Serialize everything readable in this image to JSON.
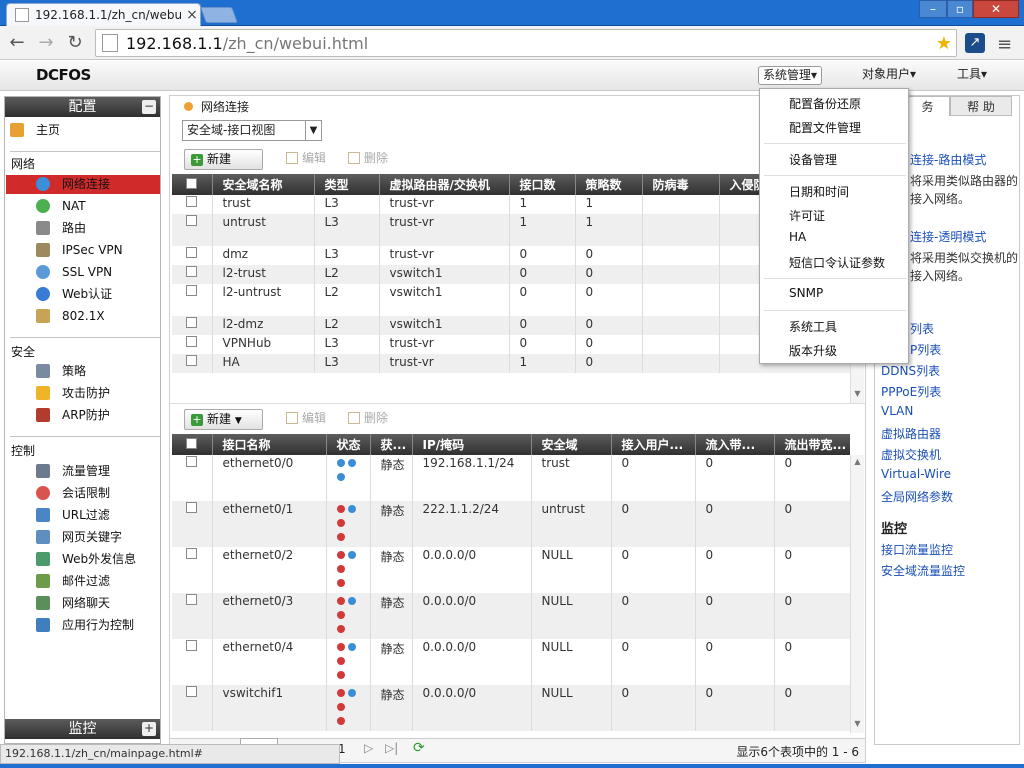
{
  "browser": {
    "tab_title": "192.168.1.1/zh_cn/webu",
    "url_host": "192.168.1.1",
    "url_path": "/zh_cn/webui.html",
    "status_url": "192.168.1.1/zh_cn/mainpage.html#"
  },
  "header": {
    "logo": "DCFOS",
    "menu": [
      "系统管理▾",
      "对象用户▾",
      "工具▾"
    ]
  },
  "sidebar": {
    "config_title": "配置",
    "home": "主页",
    "sections": [
      {
        "title": "网络",
        "items": [
          "网络连接",
          "NAT",
          "路由",
          "IPSec VPN",
          "SSL VPN",
          "Web认证",
          "802.1X"
        ]
      },
      {
        "title": "安全",
        "items": [
          "策略",
          "攻击防护",
          "ARP防护"
        ]
      },
      {
        "title": "控制",
        "items": [
          "流量管理",
          "会话限制",
          "URL过滤",
          "网页关键字",
          "Web外发信息",
          "邮件过滤",
          "网络聊天",
          "应用行为控制"
        ]
      }
    ],
    "selected": "网络连接",
    "monitor_title": "监控"
  },
  "main": {
    "breadcrumb": "网络连接",
    "view_select": "安全域-接口视图",
    "toolbar_new": "新建",
    "toolbar_edit": "编辑",
    "toolbar_delete": "删除",
    "zones": {
      "columns": [
        "安全域名称",
        "类型",
        "虚拟路由器/交换机",
        "接口数",
        "策略数",
        "防病毒",
        "入侵防"
      ],
      "rows": [
        [
          "trust",
          "L3",
          "trust-vr",
          "1",
          "1"
        ],
        [
          "untrust",
          "L3",
          "trust-vr",
          "1",
          "1"
        ],
        [
          "dmz",
          "L3",
          "trust-vr",
          "0",
          "0"
        ],
        [
          "l2-trust",
          "L2",
          "vswitch1",
          "0",
          "0"
        ],
        [
          "l2-untrust",
          "L2",
          "vswitch1",
          "0",
          "0"
        ],
        [
          "l2-dmz",
          "L2",
          "vswitch1",
          "0",
          "0"
        ],
        [
          "VPNHub",
          "L3",
          "trust-vr",
          "0",
          "0"
        ],
        [
          "HA",
          "L3",
          "trust-vr",
          "1",
          "0"
        ]
      ]
    },
    "interfaces": {
      "columns": [
        "接口名称",
        "状态",
        "获...",
        "IP/掩码",
        "安全域",
        "接入用户...",
        "流入带...",
        "流出带宽..."
      ],
      "rows": [
        [
          "ethernet0/0",
          "静态",
          "192.168.1.1/24",
          "trust",
          "0",
          "0",
          "0"
        ],
        [
          "ethernet0/1",
          "静态",
          "222.1.1.2/24",
          "untrust",
          "0",
          "0",
          "0"
        ],
        [
          "ethernet0/2",
          "静态",
          "0.0.0.0/0",
          "NULL",
          "0",
          "0",
          "0"
        ],
        [
          "ethernet0/3",
          "静态",
          "0.0.0.0/0",
          "NULL",
          "0",
          "0",
          "0"
        ],
        [
          "ethernet0/4",
          "静态",
          "0.0.0.0/0",
          "NULL",
          "0",
          "0",
          "0"
        ],
        [
          "vswitchif1",
          "静态",
          "0.0.0.0/0",
          "NULL",
          "0",
          "0",
          "0"
        ]
      ]
    },
    "pager_page": "1",
    "pager_info": "显示6个表项中的 1 - 6"
  },
  "dropdown": {
    "groups": [
      [
        "配置备份还原",
        "配置文件管理"
      ],
      [
        "设备管理"
      ],
      [
        "日期和时间",
        "许可证",
        "HA",
        "短信口令认证参数"
      ],
      [
        "SNMP"
      ],
      [
        "系统工具",
        "版本升级"
      ]
    ]
  },
  "right_panel": {
    "tab_tasks": "务",
    "tab_help": "帮 助",
    "route_link": "连接-路由模式",
    "route_desc_1": "将采用类似路由器的",
    "route_desc_2": "接入网络。",
    "transparent_link": "连接-透明模式",
    "transparent_desc_1": "将采用类似交换机的",
    "transparent_desc_2": "接入网络。",
    "links": [
      "列表",
      "P列表",
      "DDNS列表",
      "PPPoE列表",
      "VLAN",
      "虚拟路由器",
      "虚拟交换机",
      "Virtual-Wire",
      "全局网络参数"
    ],
    "monitor_title": "监控",
    "monitor_links": [
      "接口流量监控",
      "安全域流量监控"
    ]
  },
  "colors": {
    "selected_bg": "#d12a2a",
    "link": "#1a4fb5",
    "header_bar": "#1e6fcf"
  }
}
